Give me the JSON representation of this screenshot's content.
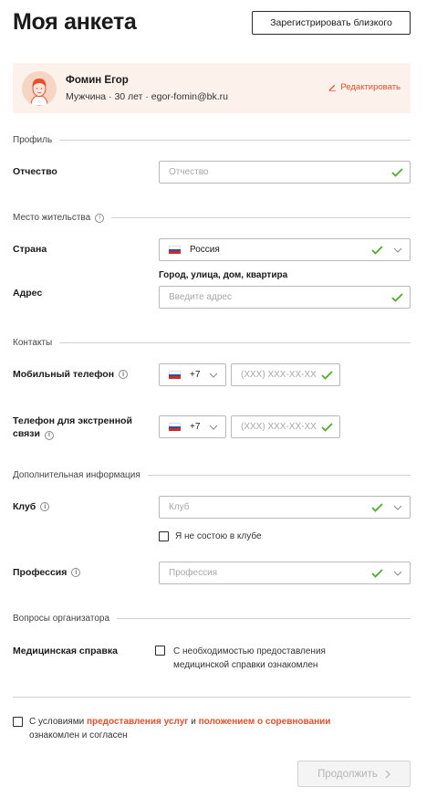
{
  "page": {
    "title": "Моя анкета",
    "register_label": "Зарегистрировать близкого"
  },
  "profile": {
    "name": "Фомин Егор",
    "meta": "Мужчина · 30 лет · egor-fomin@bk.ru",
    "edit_label": "Редактировать"
  },
  "sections": {
    "profile": "Профиль",
    "residence": "Место жительства",
    "contacts": "Контакты",
    "additional": "Дополнительная информация",
    "organizer": "Вопросы организатора"
  },
  "fields": {
    "patronymic": {
      "label": "Отчество",
      "placeholder": "Отчество"
    },
    "country": {
      "label": "Страна",
      "value": "Россия"
    },
    "address": {
      "label": "Адрес",
      "sublabel": "Город, улица, дом, квартира",
      "placeholder": "Введите адрес"
    },
    "mobile": {
      "label": "Мобильный телефон",
      "code": "+7",
      "placeholder": "(XXX) XXX-XX-XX"
    },
    "emergency": {
      "label_line1": "Телефон для экстренной",
      "label_line2": "связи",
      "code": "+7",
      "placeholder": "(XXX) XXX-XX-XX"
    },
    "club": {
      "label": "Клуб",
      "placeholder": "Клуб",
      "no_club_label": "Я не состою в клубе"
    },
    "profession": {
      "label": "Профессия",
      "placeholder": "Профессия"
    },
    "medical": {
      "label": "Медицинская справка",
      "checkbox_line1": "С необходимостью предоставления",
      "checkbox_line2": "медицинской справки ознакомлен"
    }
  },
  "agreement": {
    "prefix": "С условиями",
    "link1": "предоставления услуг",
    "middle": "и",
    "link2": "положением о соревновании",
    "suffix": "ознакомлен и согласен"
  },
  "continue_label": "Продолжить",
  "colors": {
    "accent": "#e8502c",
    "check": "#4caf2a",
    "card_bg": "#fdf1ec"
  },
  "icons": {
    "info": "i",
    "edit": "pencil-icon",
    "check": "check-icon",
    "chevron": "chevron-down-icon",
    "flag": "russia-flag-icon"
  }
}
